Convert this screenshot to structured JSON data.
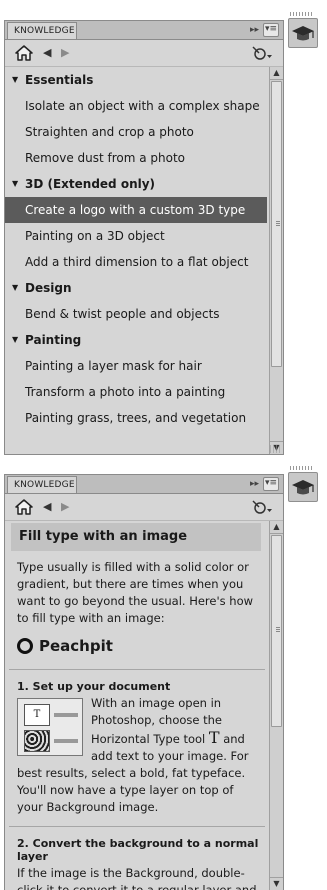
{
  "panel_title": "KNOWLEDGE",
  "panel_controls": {
    "collapse": "▸▸",
    "menu": "▾≡"
  },
  "toolbar": {
    "back": "◀",
    "forward": "▶"
  },
  "scrollbar": {
    "up": "▲",
    "down": "▼"
  },
  "top_panel": {
    "sections": [
      {
        "title": "Essentials",
        "items": [
          "Isolate an object with a complex shape",
          "Straighten and crop a photo",
          "Remove dust from a photo"
        ]
      },
      {
        "title": "3D (Extended only)",
        "items": [
          "Create a logo with a custom 3D type",
          "Painting on a 3D object",
          "Add a third dimension to a flat object"
        ]
      },
      {
        "title": "Design",
        "items": [
          "Bend & twist people and objects"
        ]
      },
      {
        "title": "Painting",
        "items": [
          "Painting a layer mask for hair",
          "Transform a photo into a painting",
          "Painting grass, trees, and vegetation"
        ]
      }
    ],
    "selected_item": "Create a logo with a custom 3D type"
  },
  "article": {
    "title": "Fill type with an image",
    "intro": "Type usually is filled with a solid color or gradient, but there are times when you want to go beyond the usual. Here's how to fill type with an image:",
    "brand": "Peachpit",
    "step1_title": "1. Set up your document",
    "step1_body_a": "With an image open in Photoshop, choose the Horizontal Type tool",
    "step1_glyph": "T",
    "step1_body_b": "and add text to your image. For best results, select a bold, fat typeface. You'll now have a type layer on top of your Background image.",
    "step2_title": "2. Convert the background to a normal layer",
    "step2_body": "If the image is the Background, double-click it to convert it to a regular layer and give it a name."
  },
  "colors": {
    "panel_bg": "#d6d6d6",
    "selected_bg": "#5b5b5b",
    "title_bar": "#c2c2c2"
  }
}
